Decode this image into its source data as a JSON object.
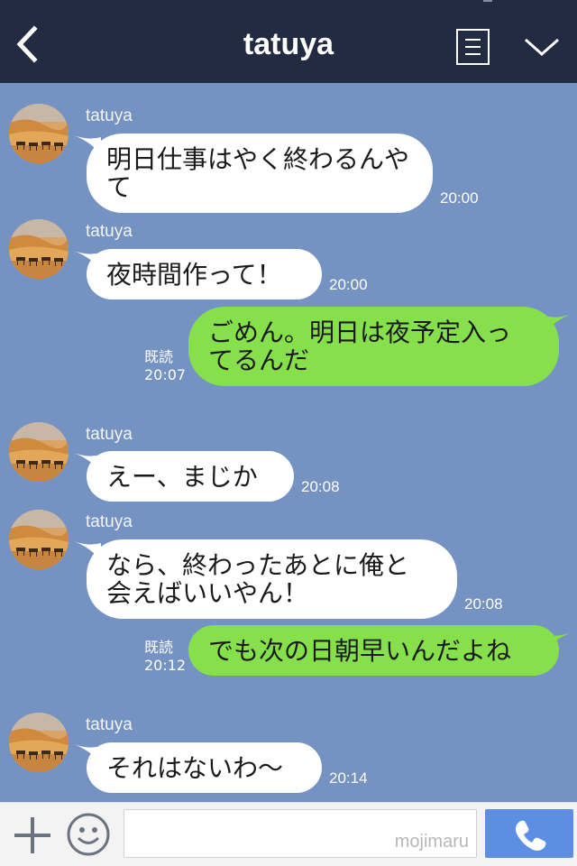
{
  "header": {
    "title": "tatuya",
    "back_icon": "chevron-left-icon",
    "menu_icon": "note-icon",
    "collapse_icon": "chevron-down-icon",
    "bg_color": "#222b42"
  },
  "chat": {
    "bg_color": "#7492c2",
    "in_bubble_color": "#ffffff",
    "out_bubble_color": "#86e04c",
    "messages": [
      {
        "from": "tatuya",
        "sender": "tatuya",
        "lines": [
          "明日仕事はやく終わるんや",
          "て"
        ],
        "time": "20:00"
      },
      {
        "from": "tatuya",
        "sender": "tatuya",
        "lines": [
          "夜時間作って！"
        ],
        "time": "20:00"
      },
      {
        "from": "me",
        "read": "既読",
        "lines": [
          "ごめん。明日は夜予定入っ",
          "てるんだ"
        ],
        "time": "20:07"
      },
      {
        "from": "tatuya",
        "sender": "tatuya",
        "lines": [
          "えー、まじか"
        ],
        "time": "20:08"
      },
      {
        "from": "tatuya",
        "sender": "tatuya",
        "lines": [
          "なら、終わったあとに俺と",
          "会えばいいやん！"
        ],
        "time": "20:08"
      },
      {
        "from": "me",
        "read": "既読",
        "lines": [
          "でも次の日朝早いんだよね"
        ],
        "time": "20:12"
      },
      {
        "from": "tatuya",
        "sender": "tatuya",
        "lines": [
          "それはないわ〜"
        ],
        "time": "20:14"
      }
    ]
  },
  "input_bar": {
    "add_icon": "plus-icon",
    "emoji_icon": "smiley-icon",
    "watermark": "mojimaru",
    "call_icon": "phone-icon",
    "call_color": "#5c8fe4"
  }
}
